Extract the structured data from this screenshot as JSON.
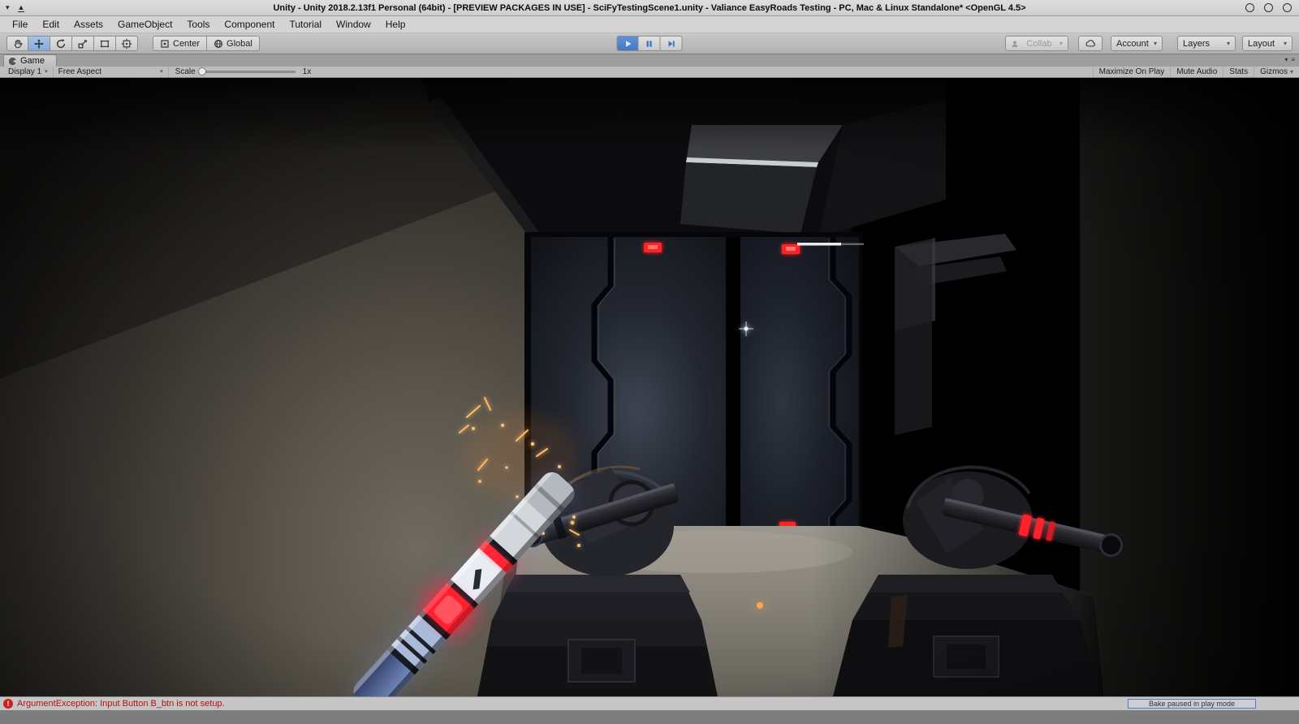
{
  "window": {
    "title": "Unity - Unity 2018.2.13f1 Personal (64bit) - [PREVIEW PACKAGES IN USE] - SciFyTestingScene1.unity - Valiance EasyRoads Testing - PC, Mac & Linux Standalone* <OpenGL 4.5>"
  },
  "menubar": {
    "items": [
      "File",
      "Edit",
      "Assets",
      "GameObject",
      "Tools",
      "Component",
      "Tutorial",
      "Window",
      "Help"
    ]
  },
  "toolbar": {
    "pivot_label": "Center",
    "space_label": "Global",
    "collab_label": "Collab",
    "account_label": "Account",
    "layers_label": "Layers",
    "layout_label": "Layout"
  },
  "game_view": {
    "tab_label": "Game",
    "display_selector": "Display 1",
    "aspect_selector": "Free Aspect",
    "scale_label": "Scale",
    "scale_value": "1x",
    "maximize_on_play": "Maximize On Play",
    "mute_audio": "Mute Audio",
    "stats": "Stats",
    "gizmos": "Gizmos"
  },
  "status_bar": {
    "error_message": "ArgumentException: Input Button B_btn is not setup.",
    "bake_status": "Bake paused in play mode"
  },
  "colors": {
    "play_button_active": "#4c84d0",
    "error_text": "#b01212",
    "door_light_red": "#ff2328",
    "spark_orange": "#ffb966",
    "weapon_glow_red": "#ff1f2e",
    "weapon_blue": "#6f84bd"
  }
}
